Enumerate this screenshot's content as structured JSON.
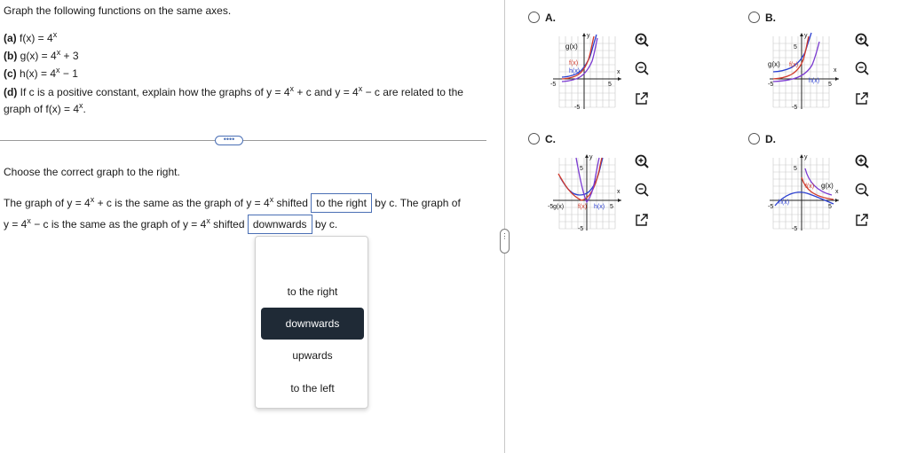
{
  "question": {
    "prompt": "Graph the following functions on the same axes.",
    "a_label": "(a)",
    "a_text": "f(x) = 4",
    "b_label": "(b)",
    "b_text": "g(x) = 4",
    "b_tail": " + 3",
    "c_label": "(c)",
    "c_text": "h(x) = 4",
    "c_tail": " − 1",
    "d_label": "(d)",
    "d_text1": "If c is a positive constant, explain how the graphs of y = 4",
    "d_text2": " + c and y = 4",
    "d_text3": " − c are related to the",
    "d_line2": "graph of f(x) = 4",
    "d_end": ".",
    "exp": "x"
  },
  "more_label": "••••",
  "instruction": "Choose the correct graph to the right.",
  "answer": {
    "s1a": "The graph of y = 4",
    "s1b": " + c is the same as the graph of y = 4",
    "s1c": " shifted",
    "dropdown1": "to the right",
    "s1d": "by c. The graph of",
    "s2a": "y = 4",
    "s2b": " − c is the same as the graph of y = 4",
    "s2c": " shifted",
    "dropdown2": "downwards",
    "s2d": "by c."
  },
  "menu_options": [
    "to the right",
    "downwards",
    "upwards",
    "to the left"
  ],
  "menu_selected": 1,
  "divider_handle": "•\n•\n•",
  "choices": [
    {
      "letter": "A.",
      "labels": [
        "g(x)",
        "f(x)",
        "h(x)"
      ],
      "axis": {
        "y": "y",
        "x": "x",
        "tick_pos": "5",
        "tick_neg": "-5",
        "ytick_neg": "-5"
      }
    },
    {
      "letter": "B.",
      "labels": [
        "g(x)",
        "f(x)",
        "h(x)"
      ],
      "axis": {
        "y": "y",
        "x": "x",
        "tick_pos": "5",
        "tick_neg": "-5",
        "ytick_pos": "5",
        "ytick_neg": "-5"
      }
    },
    {
      "letter": "C.",
      "labels": [
        "g(x)",
        "f(x)",
        "h(x)"
      ],
      "axis": {
        "y": "y",
        "x": "x",
        "tick_pos": "5",
        "tick_neg": "-5",
        "ytick_pos": "5",
        "ytick_neg": "-5"
      }
    },
    {
      "letter": "D.",
      "labels": [
        "f(x)",
        "g(x)",
        "h(x)"
      ],
      "axis": {
        "y": "y",
        "x": "x",
        "tick_pos": "5",
        "tick_neg": "-5",
        "ytick_pos": "5",
        "ytick_neg": "-5"
      }
    }
  ],
  "icons": [
    "zoom-in-icon",
    "zoom-out-icon",
    "open-new-window-icon"
  ],
  "colors": {
    "accent": "#4a6fb5",
    "selected_bg": "#1f2a36",
    "curve_blue": "#2b3fd1",
    "curve_red": "#d13a2b",
    "curve_purple": "#7a3ad1"
  }
}
